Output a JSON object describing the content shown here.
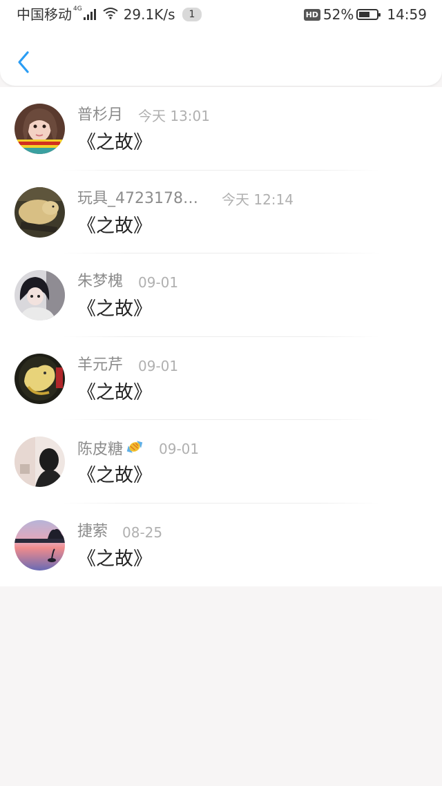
{
  "status_bar": {
    "carrier": "中国移动",
    "network": "4G",
    "speed": "29.1K/s",
    "notification_count": "1",
    "hd": "HD",
    "battery": "52%",
    "battery_level": 0.52,
    "time": "14:59"
  },
  "header": {
    "back_icon": "chevron-left-icon",
    "accent_color": "#2a9df4"
  },
  "items": [
    {
      "name": "普杉月",
      "time": "今天 13:01",
      "message": "《之故》",
      "avatar": "avatar-girl"
    },
    {
      "name": "玩具_4723178…",
      "time": "今天 12:14",
      "message": "《之故》",
      "avatar": "avatar-dog"
    },
    {
      "name": "朱梦槐",
      "time": "09-01",
      "message": "《之故》",
      "avatar": "avatar-anime"
    },
    {
      "name": "羊元芹",
      "time": "09-01",
      "message": "《之故》",
      "avatar": "avatar-yellow-art"
    },
    {
      "name": "陈皮糖",
      "time": "09-01",
      "message": "《之故》",
      "avatar": "avatar-room",
      "name_icon": "candy-icon"
    },
    {
      "name": "捷萦",
      "time": "08-25",
      "message": "《之故》",
      "avatar": "avatar-sunset"
    }
  ]
}
